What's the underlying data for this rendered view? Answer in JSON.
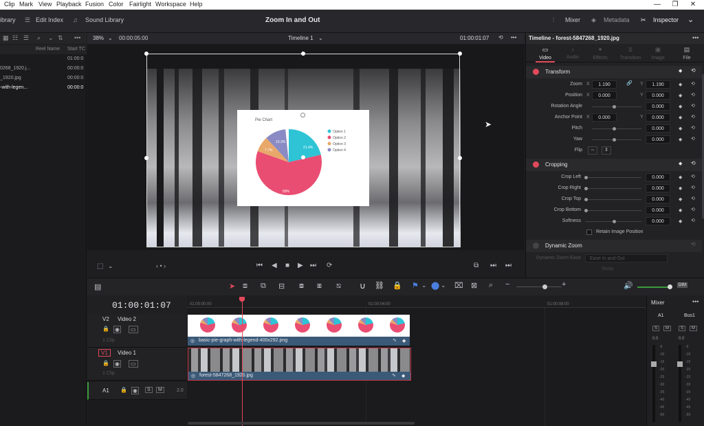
{
  "menubar": {
    "items": [
      "Clip",
      "Mark",
      "View",
      "Playback",
      "Fusion",
      "Color",
      "Fairlight",
      "Workspace",
      "Help"
    ]
  },
  "topbar": {
    "library_label": "ibrary",
    "edit_index_label": "Edit Index",
    "sound_library_label": "Sound Library",
    "project_title": "Zoom In and Out",
    "mixer_label": "Mixer",
    "metadata_label": "Metadata",
    "inspector_label": "Inspector"
  },
  "mediapool": {
    "col_reel": "Reel Name",
    "col_start": "Start TC",
    "rows": [
      {
        "name": "",
        "tc": "01:00:0"
      },
      {
        "name": "0268_1920.j...",
        "tc": "00:00:0"
      },
      {
        "name": "_1920.jpg",
        "tc": "00:00:0"
      },
      {
        "name": "-with-legen...",
        "tc": "00:00:0"
      }
    ]
  },
  "viewer": {
    "zoom": "38%",
    "source_tc": "00:00:05:00",
    "timeline_name": "Timeline 1",
    "record_tc": "01:00:01:07"
  },
  "pie": {
    "title": "Pie Chart",
    "legend": [
      "Option 1",
      "Option 2",
      "Option 3",
      "Option 4"
    ],
    "colors": [
      "#2ec4d6",
      "#ea4d72",
      "#e8a86a",
      "#8a8bc4"
    ],
    "labels": {
      "o1": "21.4%",
      "o2": "59%",
      "o3": "7.7%",
      "o4": "10.3%"
    }
  },
  "inspector": {
    "clip_title": "Timeline - forest-5847268_1920.jpg",
    "tabs": [
      "Video",
      "Audio",
      "Effects",
      "Transition",
      "Image",
      "File"
    ],
    "transform": {
      "title": "Transform",
      "zoom_label": "Zoom",
      "zoom_x": "1.190",
      "zoom_y": "1.190",
      "position_label": "Position",
      "pos_x": "0.000",
      "pos_y": "0.000",
      "rotation_label": "Rotation Angle",
      "rotation": "0.000",
      "anchor_label": "Anchor Point",
      "anchor_x": "0.000",
      "anchor_y": "0.000",
      "pitch_label": "Pitch",
      "pitch": "0.000",
      "yaw_label": "Yaw",
      "yaw": "0.000",
      "flip_label": "Flip",
      "x_axis": "X",
      "y_axis": "Y"
    },
    "cropping": {
      "title": "Cropping",
      "left_label": "Crop Left",
      "left": "0.000",
      "right_label": "Crop Right",
      "right": "0.000",
      "top_label": "Crop Top",
      "top": "0.000",
      "bottom_label": "Crop Bottom",
      "bottom": "0.000",
      "softness_label": "Softness",
      "softness": "0.000",
      "retain_label": "Retain Image Position"
    },
    "dynamic_zoom": {
      "title": "Dynamic Zoom",
      "ease_label": "Dynamic Zoom Ease",
      "ease_value": "Ease In and Out",
      "swap_label": "Swap"
    }
  },
  "timeline": {
    "timecode": "01:00:01:07",
    "ruler": [
      "01:00:00:00",
      "01:00:04:00",
      "01:00:08:00"
    ],
    "v2": {
      "id": "V2",
      "name": "Video 2",
      "clips": "1 Clip",
      "clip_name": "basic-pie-graph-with-legend-400x292.png"
    },
    "v1": {
      "id": "V1",
      "name": "Video 1",
      "clips": "1 Clip",
      "clip_name": "forest-5847268_1920.jpg"
    },
    "a1": {
      "id": "A1",
      "level": "2.0",
      "s": "S",
      "m": "M"
    },
    "dim_label": "DIM"
  },
  "mixer": {
    "title": "Mixer",
    "ch1": "A1",
    "ch2": "Bus1",
    "s": "S",
    "m": "M",
    "val": "0.0",
    "scale": [
      "-5",
      "-10",
      "-15",
      "-20",
      "-25",
      "-30",
      "-35",
      "-40",
      "-45",
      "-50"
    ]
  }
}
